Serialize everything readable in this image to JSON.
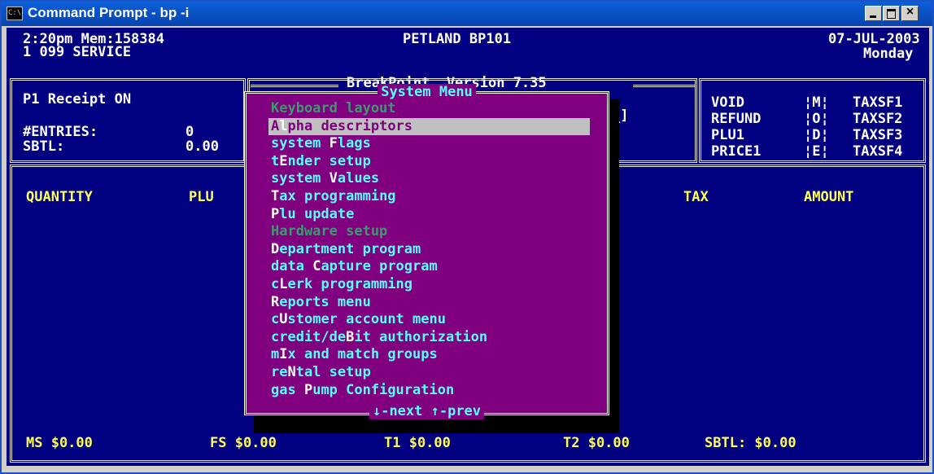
{
  "window": {
    "title": "Command Prompt - bp -i",
    "icon": "console-icon",
    "icon_text": "C:\\",
    "minimize": "minimize-icon",
    "maximize": "maximize-icon",
    "close": "close-icon",
    "close_glyph": "×"
  },
  "header": {
    "time_mem": "2:20pm Mem:158384",
    "service": "1 099 SERVICE",
    "store": "PETLAND BP101",
    "date": "07-JUL-2003",
    "weekday": "Monday",
    "version": "BreakPoint  Version 7.35"
  },
  "left_panel": {
    "receipt": "P1 Receipt ON",
    "entries_label": "#ENTRIES:",
    "entries_value": "0",
    "sbtl_label": "SBTL:",
    "sbtl_value": "0.00"
  },
  "right_panel": {
    "rows": [
      {
        "key": "VOID",
        "code": "¦M¦",
        "tax": "TAXSF1"
      },
      {
        "key": "REFUND",
        "code": "¦O¦",
        "tax": "TAXSF2"
      },
      {
        "key": "PLU1",
        "code": "¦D¦",
        "tax": "TAXSF3"
      },
      {
        "key": "PRICE1",
        "code": "¦E¦",
        "tax": "TAXSF4"
      }
    ]
  },
  "columns": {
    "quantity": "QUANTITY",
    "plu": "PLU",
    "tax": "TAX",
    "amount": "AMOUNT"
  },
  "input_bracket": "_]",
  "menu": {
    "title": "System Menu",
    "footer": "↓-next ↑-prev",
    "items": [
      {
        "pre": "Keyboard layout",
        "hk": "",
        "post": "",
        "state": "disabled"
      },
      {
        "pre": "A",
        "hk": "l",
        "post": "pha descriptors",
        "state": "selected"
      },
      {
        "pre": "system ",
        "hk": "F",
        "post": "lags",
        "state": "normal"
      },
      {
        "pre": "t",
        "hk": "E",
        "post": "nder setup",
        "state": "normal"
      },
      {
        "pre": "system ",
        "hk": "V",
        "post": "alues",
        "state": "normal"
      },
      {
        "pre": "",
        "hk": "T",
        "post": "ax programming",
        "state": "normal"
      },
      {
        "pre": "",
        "hk": "P",
        "post": "lu update",
        "state": "normal"
      },
      {
        "pre": "Hardware setup",
        "hk": "",
        "post": "",
        "state": "disabled"
      },
      {
        "pre": "",
        "hk": "D",
        "post": "epartment program",
        "state": "normal"
      },
      {
        "pre": "data ",
        "hk": "C",
        "post": "apture program",
        "state": "normal"
      },
      {
        "pre": "c",
        "hk": "L",
        "post": "erk programming",
        "state": "normal"
      },
      {
        "pre": "",
        "hk": "R",
        "post": "eports menu",
        "state": "normal"
      },
      {
        "pre": "c",
        "hk": "U",
        "post": "stomer account menu",
        "state": "normal"
      },
      {
        "pre": "credit/de",
        "hk": "B",
        "post": "it authorization",
        "state": "normal"
      },
      {
        "pre": "m",
        "hk": "I",
        "post": "x and match groups",
        "state": "normal"
      },
      {
        "pre": "re",
        "hk": "N",
        "post": "tal setup",
        "state": "normal"
      },
      {
        "pre": "gas ",
        "hk": "P",
        "post": "ump Configuration",
        "state": "normal"
      }
    ]
  },
  "status": {
    "ms": "MS $0.00",
    "fs": "FS $0.00",
    "t1": "T1 $0.00",
    "t2": "T2 $0.00",
    "sbtl": "SBTL: $0.00"
  },
  "colors": {
    "console_bg": "#000080",
    "menu_bg": "#800080",
    "highlight": "#c0c0c0",
    "text_cyan": "#55ffff",
    "text_yellow": "#ffff55",
    "text_disabled": "#3c9a6e"
  }
}
